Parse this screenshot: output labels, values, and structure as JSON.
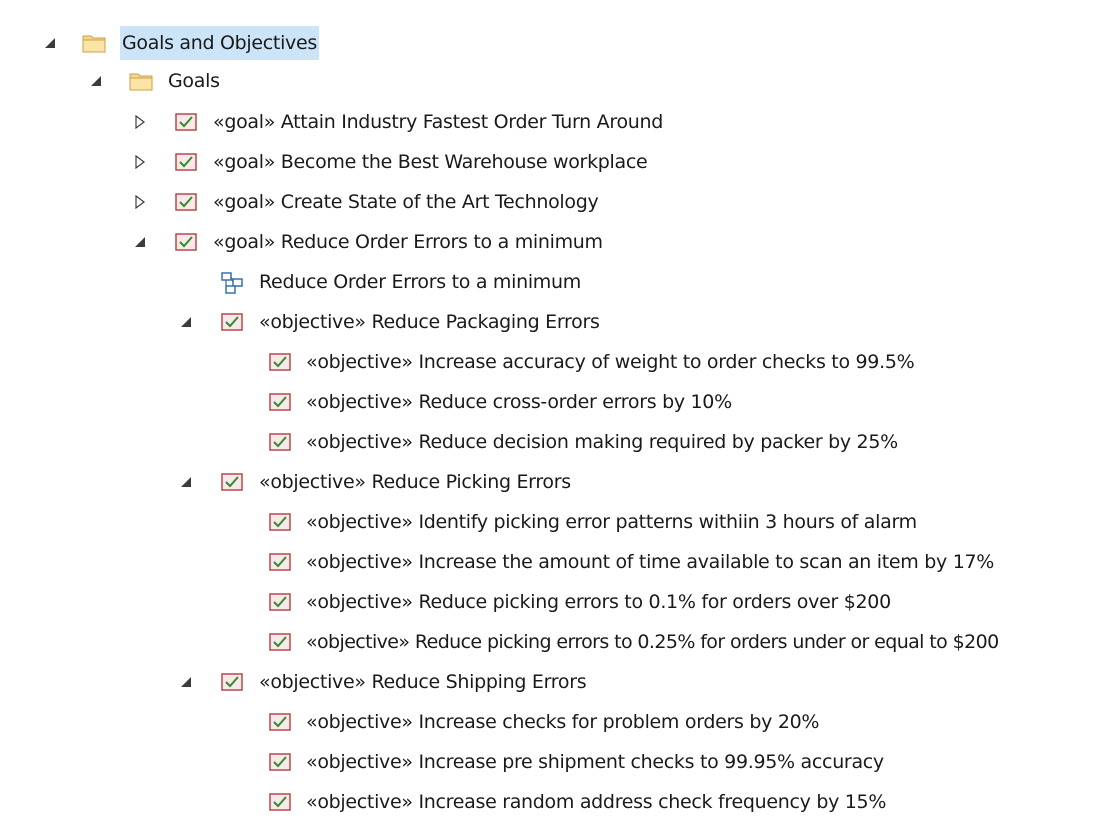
{
  "tree": {
    "root": {
      "label": "Goals and Objectives"
    },
    "goals_folder": {
      "label": "Goals"
    },
    "goal_1": {
      "label": "«goal» Attain Industry Fastest Order Turn Around"
    },
    "goal_2": {
      "label": "«goal» Become the Best Warehouse workplace"
    },
    "goal_3": {
      "label": "«goal» Create State of the Art Technology"
    },
    "goal_4": {
      "label": "«goal» Reduce Order Errors to a minimum"
    },
    "diagram_1": {
      "label": "Reduce Order Errors to a minimum"
    },
    "objective_packaging": {
      "label": "«objective» Reduce Packaging Errors"
    },
    "packaging_items": [
      {
        "label": "«objective» Increase accuracy of weight to order checks to 99.5%"
      },
      {
        "label": "«objective» Reduce cross-order errors by 10%"
      },
      {
        "label": "«objective» Reduce decision making required by packer by 25%"
      }
    ],
    "objective_picking": {
      "label": "«objective» Reduce Picking Errors"
    },
    "picking_items": [
      {
        "label": "«objective» Identify picking error patterns withiin 3 hours  of alarm"
      },
      {
        "label": "«objective» Increase the amount of time available to scan an item by 17%"
      },
      {
        "label": "«objective» Reduce picking errors to 0.1% for orders over $200"
      },
      {
        "label": "«objective» Reduce picking errors to 0.25% for orders under or equal to $200"
      }
    ],
    "objective_shipping": {
      "label": "«objective» Reduce Shipping Errors"
    },
    "shipping_items": [
      {
        "label": "«objective» Increase checks for problem orders by 20%"
      },
      {
        "label": "«objective» Increase pre shipment checks to 99.95% accuracy"
      },
      {
        "label": "«objective» Increase random address check frequency by 15%"
      }
    ]
  },
  "colors": {
    "selection": "#cce4f7",
    "folder_fill": "#f6d78a",
    "element_icon_border": "#b24a4a",
    "element_icon_check": "#2f8f2f",
    "diagram_icon": "#3a6fb0",
    "arrow": "#3c3c3c"
  },
  "icons": {
    "expanded": "triangle-expanded-icon",
    "collapsed": "triangle-collapsed-icon",
    "folder": "folder-icon",
    "element": "checked-element-icon",
    "diagram": "diagram-icon"
  }
}
